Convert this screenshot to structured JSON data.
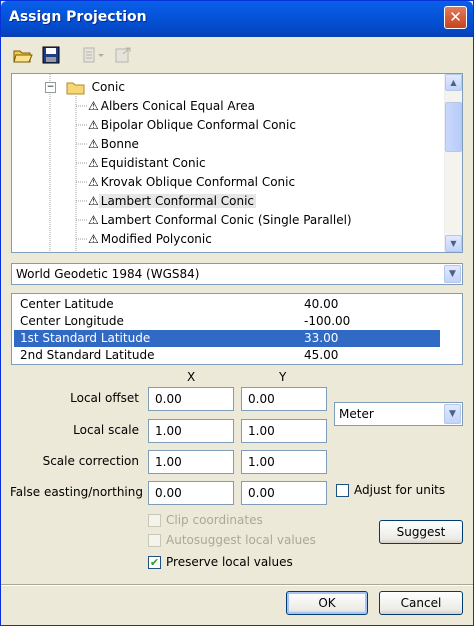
{
  "window": {
    "title": "Assign Projection"
  },
  "tree": {
    "group": "Conic",
    "items": [
      "Albers Conical Equal Area",
      "Bipolar Oblique Conformal Conic",
      "Bonne",
      "Equidistant Conic",
      "Krovak Oblique Conformal Conic",
      "Lambert Conformal Conic",
      "Lambert Conformal Conic (Single Parallel)",
      "Modified Polyconic"
    ],
    "selected_item": "Lambert Conformal Conic"
  },
  "datum": {
    "selected": "World Geodetic 1984 (WGS84)"
  },
  "parameters": [
    {
      "name": "Center Latitude",
      "value": "40.00"
    },
    {
      "name": "Center Longitude",
      "value": "-100.00"
    },
    {
      "name": "1st Standard Latitude",
      "value": "33.00"
    },
    {
      "name": "2nd Standard Latitude",
      "value": "45.00"
    }
  ],
  "offsets": {
    "col_x": "X",
    "col_y": "Y",
    "local_offset_label": "Local offset",
    "local_scale_label": "Local scale",
    "scale_correction_label": "Scale correction",
    "false_easting_label": "False easting/northing",
    "local_offset_x": "0.00",
    "local_offset_y": "0.00",
    "local_scale_x": "1.00",
    "local_scale_y": "1.00",
    "scale_correction_x": "1.00",
    "scale_correction_y": "1.00",
    "false_easting_x": "0.00",
    "false_easting_y": "0.00"
  },
  "units": {
    "selected": "Meter"
  },
  "options": {
    "adjust_for_units": {
      "label": "Adjust for units",
      "checked": false
    },
    "clip_coordinates": {
      "label": "Clip coordinates",
      "checked": false,
      "disabled": true
    },
    "autosuggest_local_values": {
      "label": "Autosuggest local values",
      "checked": false,
      "disabled": true
    },
    "preserve_local_values": {
      "label": "Preserve local values",
      "checked": true
    }
  },
  "buttons": {
    "suggest": "Suggest",
    "ok": "OK",
    "cancel": "Cancel"
  },
  "colors": {
    "titlebar": "#0554DA",
    "selection": "#316AC5",
    "dialog_bg": "#ECE9D8"
  }
}
